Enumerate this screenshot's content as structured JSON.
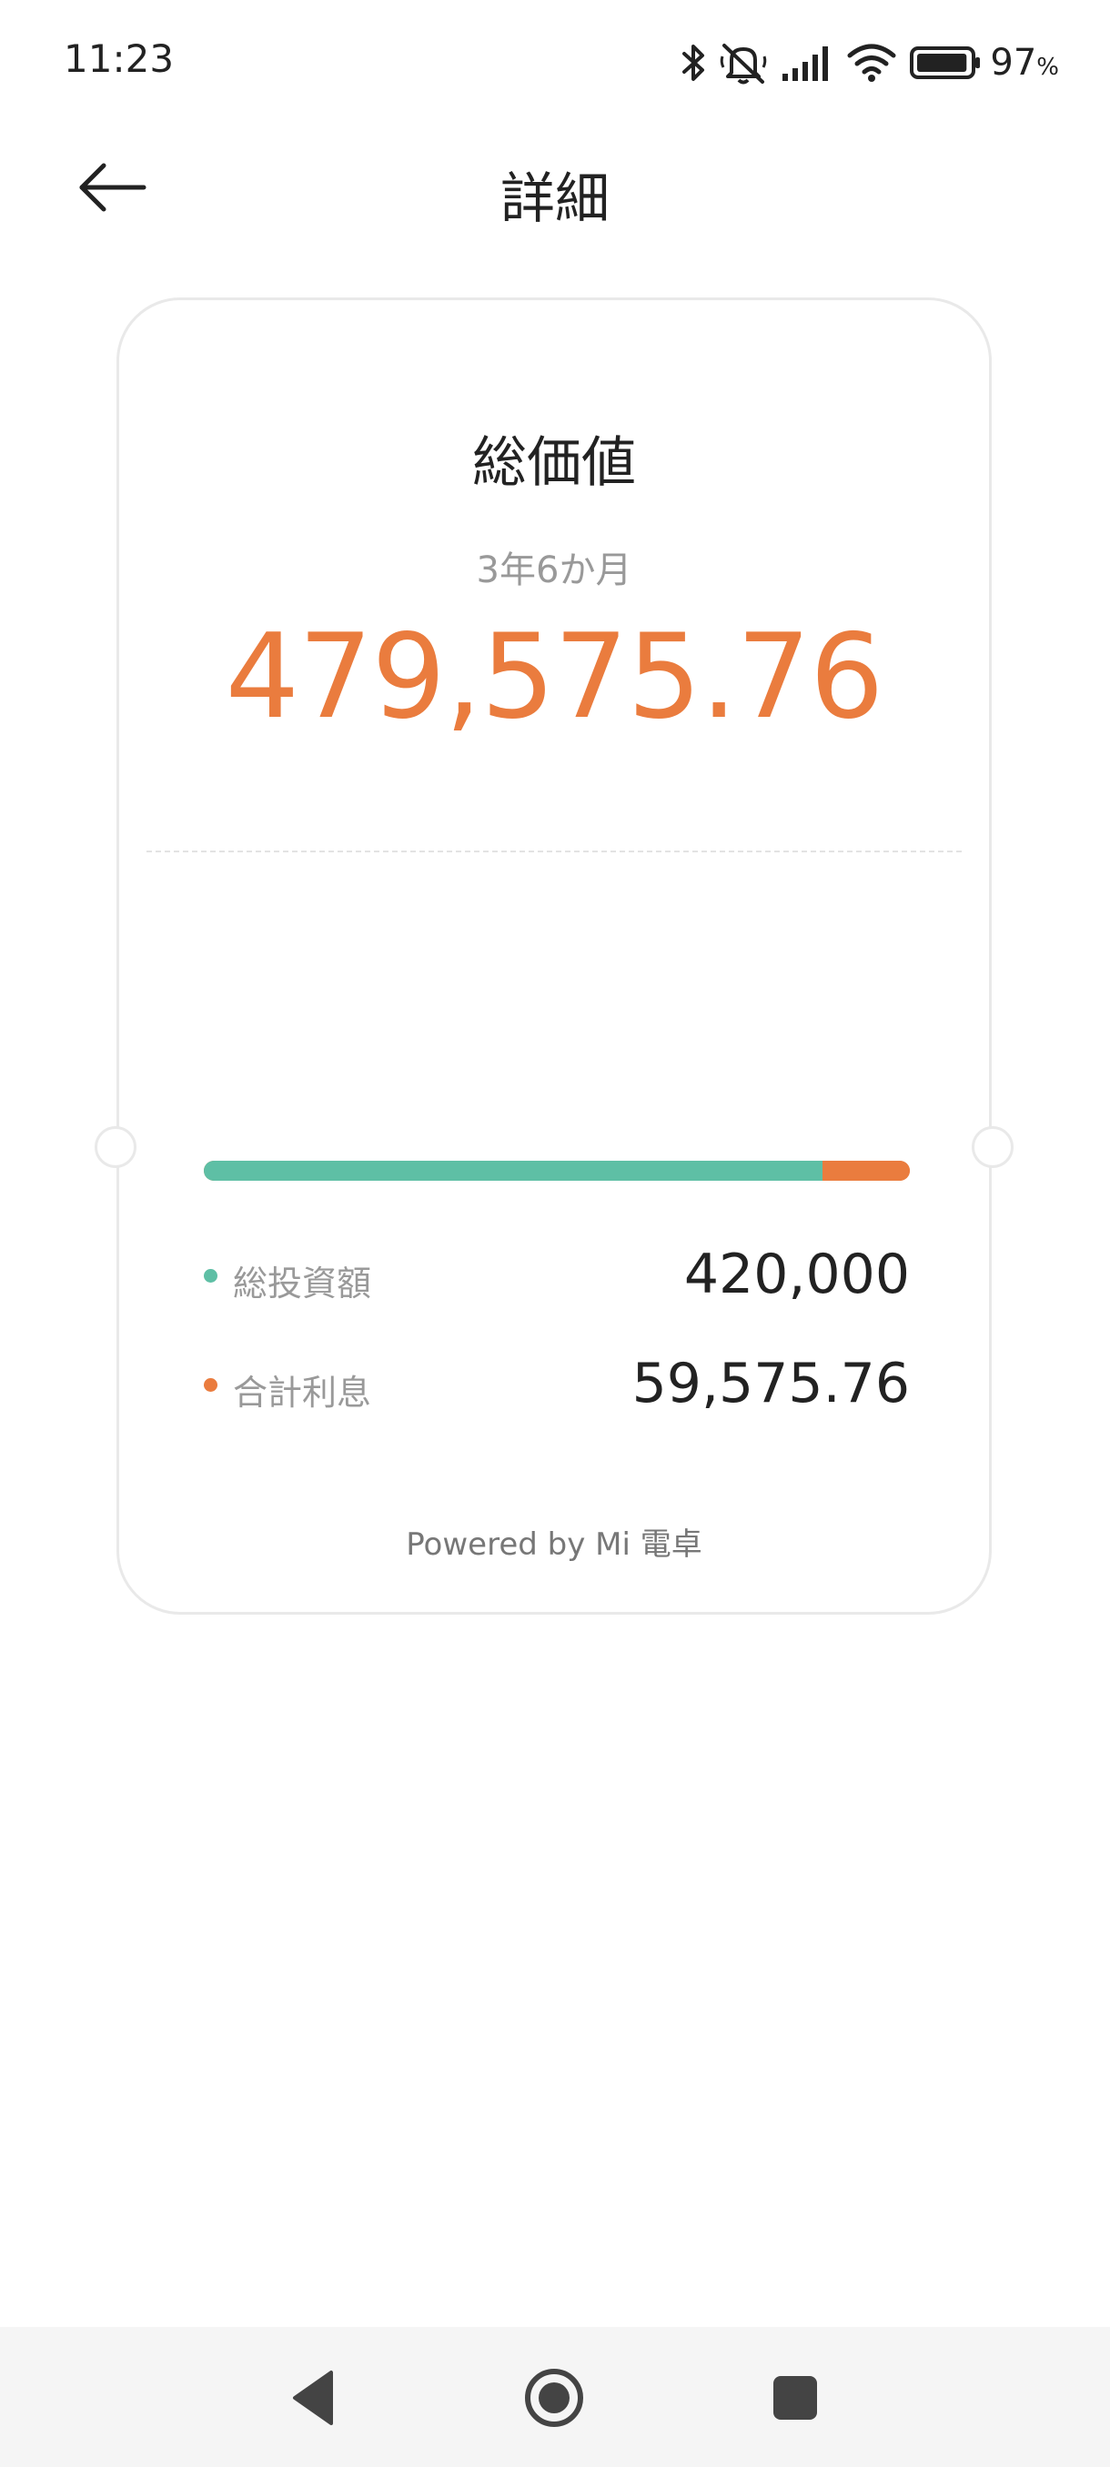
{
  "status_bar": {
    "time": "11:23",
    "battery_percent": "97",
    "battery_percent_unit": "%",
    "battery_level": 0.97,
    "icons": [
      "bluetooth-icon",
      "notifications-muted-icon",
      "cellular-signal-icon",
      "wifi-icon",
      "battery-icon"
    ]
  },
  "header": {
    "title": "詳細",
    "back_icon": "arrow-left-icon"
  },
  "card": {
    "title": "総価値",
    "period": "3年6か月",
    "total_value": "479,575.76",
    "breakdown": [
      {
        "label": "総投資額",
        "value": "420,000",
        "amount": 420000,
        "color": "#5ebfa5"
      },
      {
        "label": "合計利息",
        "value": "59,575.76",
        "amount": 59575.76,
        "color": "#ea7c3e"
      }
    ],
    "powered_by": "Powered by Mi 電卓"
  },
  "colors": {
    "accent": "#ea7c3e",
    "principal": "#5ebfa5",
    "interest": "#ea7c3e"
  },
  "nav_bar": {
    "icons": [
      "triangle-back-icon",
      "circle-home-icon",
      "square-recents-icon"
    ]
  }
}
